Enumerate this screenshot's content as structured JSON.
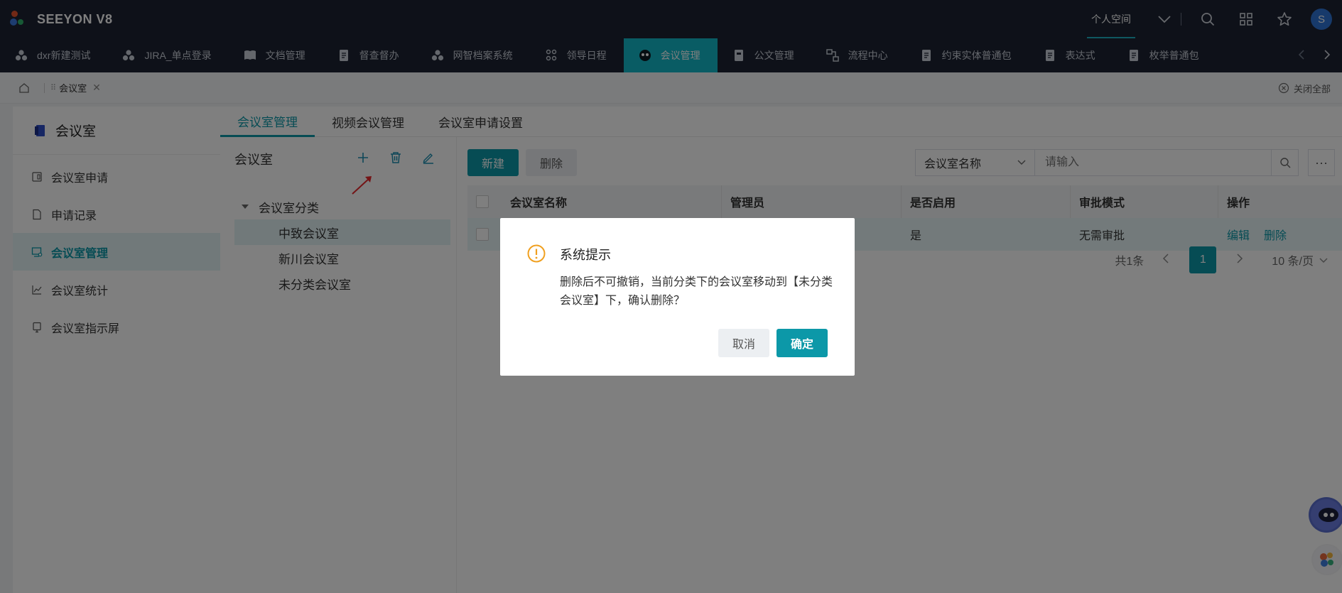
{
  "brand": {
    "name": "SEEYON V8"
  },
  "topbar": {
    "space_label": "个人空间",
    "avatar_letter": "S"
  },
  "apps": [
    {
      "label": "dxr新建测试",
      "icon": "cluster-icon"
    },
    {
      "label": "JIRA_单点登录",
      "icon": "cluster-icon"
    },
    {
      "label": "文档管理",
      "icon": "book-icon"
    },
    {
      "label": "督查督办",
      "icon": "document-icon"
    },
    {
      "label": "网智档案系统",
      "icon": "cluster-icon"
    },
    {
      "label": "领导日程",
      "icon": "people-icon"
    },
    {
      "label": "会议管理",
      "icon": "meeting-icon",
      "active": true
    },
    {
      "label": "公文管理",
      "icon": "file-icon"
    },
    {
      "label": "流程中心",
      "icon": "flow-icon"
    },
    {
      "label": "约束实体普通包",
      "icon": "document-icon"
    },
    {
      "label": "表达式",
      "icon": "document-icon"
    },
    {
      "label": "枚举普通包",
      "icon": "document-icon"
    }
  ],
  "breadcrumb": {
    "tab_label": "会议室",
    "close_all_label": "关闭全部"
  },
  "leftnav": {
    "title": "会议室",
    "items": [
      {
        "label": "会议室申请",
        "icon": "door-icon"
      },
      {
        "label": "申请记录",
        "icon": "file-icon"
      },
      {
        "label": "会议室管理",
        "icon": "monitor-settings-icon",
        "active": true
      },
      {
        "label": "会议室统计",
        "icon": "chart-icon"
      },
      {
        "label": "会议室指示屏",
        "icon": "screen-icon"
      }
    ]
  },
  "tabs": [
    "会议室管理",
    "视频会议管理",
    "会议室申请设置"
  ],
  "tree": {
    "title": "会议室",
    "root": "会议室分类",
    "children": [
      "中致会议室",
      "新川会议室",
      "未分类会议室"
    ]
  },
  "toolbar": {
    "new_label": "新建",
    "delete_label": "删除",
    "search_field": "会议室名称",
    "search_placeholder": "请输入"
  },
  "table": {
    "headers": [
      "会议室名称",
      "管理员",
      "是否启用",
      "审批模式",
      "操作"
    ],
    "rows": [
      {
        "name": "",
        "admin": "",
        "enabled": "是",
        "approval": "无需审批",
        "actions": [
          "编辑",
          "删除"
        ]
      }
    ]
  },
  "pager": {
    "total": "共1条",
    "current": "1",
    "page_size": "10 条/页"
  },
  "modal": {
    "title": "系统提示",
    "message": "删除后不可撤销，当前分类下的会议室移动到【未分类会议室】下，确认删除？",
    "cancel_label": "取消",
    "ok_label": "确定"
  },
  "colors": {
    "accent": "#0c98a8",
    "topbar": "#1c2333",
    "warning": "#f0a020"
  }
}
